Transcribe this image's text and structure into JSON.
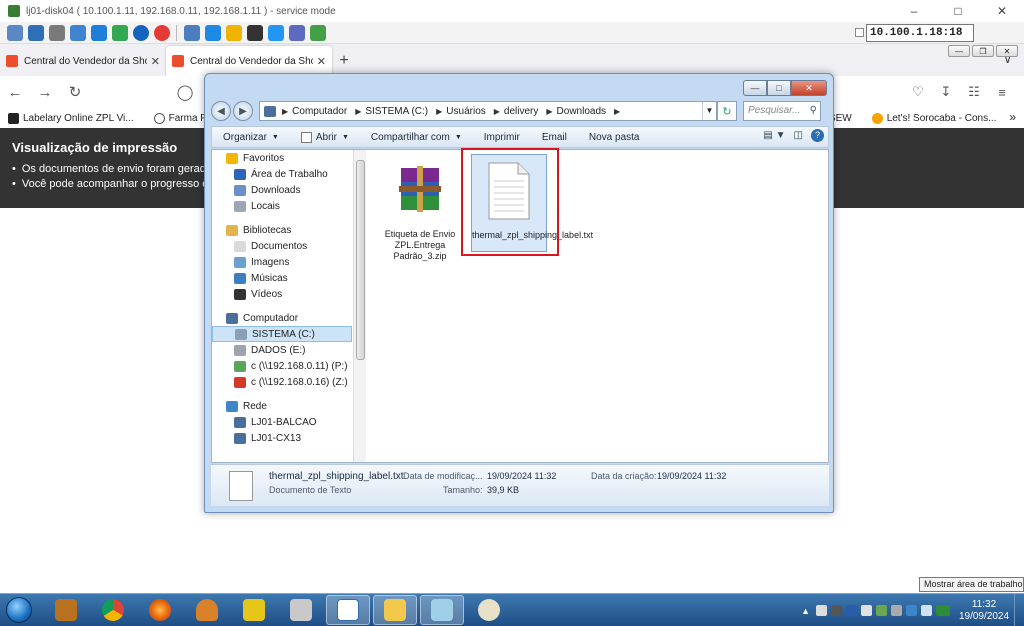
{
  "remote_window": {
    "title": "lj01-disk04 ( 10.100.1.11, 192.168.0.11, 192.168.1.11 ) - service mode",
    "ip": "10.100.1.18:18"
  },
  "browser": {
    "tabs": [
      {
        "label": "Central do Vendedor da Shopee"
      },
      {
        "label": "Central do Vendedor da Shopee"
      }
    ],
    "new_tab": "+",
    "bookmarks": [
      {
        "label": "Labelary Online ZPL Vi..."
      },
      {
        "label": "Farma Ponte ::"
      }
    ],
    "bookmarks_right": [
      {
        "label": "na SEW"
      },
      {
        "label": "Let's! Sorocaba - Cons..."
      }
    ]
  },
  "page": {
    "heading": "Visualização de impressão",
    "bullets": [
      "Os documentos de envio foram gerado",
      "Você pode acompanhar o progresso en"
    ]
  },
  "explorer": {
    "breadcrumb": [
      "Computador",
      "SISTEMA (C:)",
      "Usuários",
      "delivery",
      "Downloads"
    ],
    "search_placeholder": "Pesquisar...",
    "commands": [
      {
        "label": "Organizar",
        "has_caret": true
      },
      {
        "label": "Abrir",
        "has_caret": true
      },
      {
        "label": "Compartilhar com",
        "has_caret": true
      },
      {
        "label": "Imprimir",
        "has_caret": false
      },
      {
        "label": "Email",
        "has_caret": false
      },
      {
        "label": "Nova pasta",
        "has_caret": false
      }
    ],
    "nav": [
      {
        "label": "Favoritos",
        "level": 0,
        "icon": "star-icon",
        "color": "#f2b705"
      },
      {
        "label": "Área de Trabalho",
        "level": 1,
        "icon": "desktop-icon",
        "color": "#2d64b3"
      },
      {
        "label": "Downloads",
        "level": 1,
        "icon": "downloads-folder-icon",
        "color": "#6b8fc7"
      },
      {
        "label": "Locais",
        "level": 1,
        "icon": "recent-places-icon",
        "color": "#9aa7b5"
      },
      {
        "label": "",
        "level": -1
      },
      {
        "label": "Bibliotecas",
        "level": 0,
        "icon": "libraries-icon",
        "color": "#e3b44b"
      },
      {
        "label": "Documentos",
        "level": 1,
        "icon": "documents-icon",
        "color": "#d9d9d9"
      },
      {
        "label": "Imagens",
        "level": 1,
        "icon": "pictures-icon",
        "color": "#6a9fd1"
      },
      {
        "label": "Músicas",
        "level": 1,
        "icon": "music-icon",
        "color": "#3f7fc0"
      },
      {
        "label": "Vídeos",
        "level": 1,
        "icon": "videos-icon",
        "color": "#333333"
      },
      {
        "label": "",
        "level": -1
      },
      {
        "label": "Computador",
        "level": 0,
        "icon": "computer-icon",
        "color": "#4a6f9a"
      },
      {
        "label": "SISTEMA (C:)",
        "level": 1,
        "icon": "drive-c-icon",
        "color": "#8aa0b5",
        "selected": true
      },
      {
        "label": "DADOS (E:)",
        "level": 1,
        "icon": "drive-icon",
        "color": "#9aa5b0"
      },
      {
        "label": "c (\\\\192.168.0.11) (P:)",
        "level": 1,
        "icon": "network-drive-icon",
        "color": "#5aa55a"
      },
      {
        "label": "c (\\\\192.168.0.16) (Z:)",
        "level": 1,
        "icon": "disconnected-drive-icon",
        "color": "#d33a2a"
      },
      {
        "label": "",
        "level": -1
      },
      {
        "label": "Rede",
        "level": 0,
        "icon": "network-icon",
        "color": "#3f86c8"
      },
      {
        "label": "LJ01-BALCAO",
        "level": 1,
        "icon": "network-pc-icon",
        "color": "#4a6f9a"
      },
      {
        "label": "LJ01-CX13",
        "level": 1,
        "icon": "network-pc-icon",
        "color": "#4a6f9a"
      }
    ],
    "files": [
      {
        "name": "Etiqueta de Envio ZPL.Entrega Padrão_3.zip",
        "icon": "winrar-archive-icon"
      },
      {
        "name": "thermal_zpl_shipping_label.txt",
        "icon": "text-file-icon",
        "selected": true
      }
    ],
    "details": {
      "filename": "thermal_zpl_shipping_label.txt",
      "type": "Documento de Texto",
      "modified_label": "Data de modificaç...",
      "modified_value": "19/09/2024 11:32",
      "created_label": "Data da criação:",
      "created_value": "19/09/2024 11:32",
      "size_label": "Tamanho:",
      "size_value": "39,9 KB"
    }
  },
  "taskbar": {
    "tooltip": "Mostrar área de trabalho",
    "time": "11:32",
    "date": "19/09/2024"
  }
}
